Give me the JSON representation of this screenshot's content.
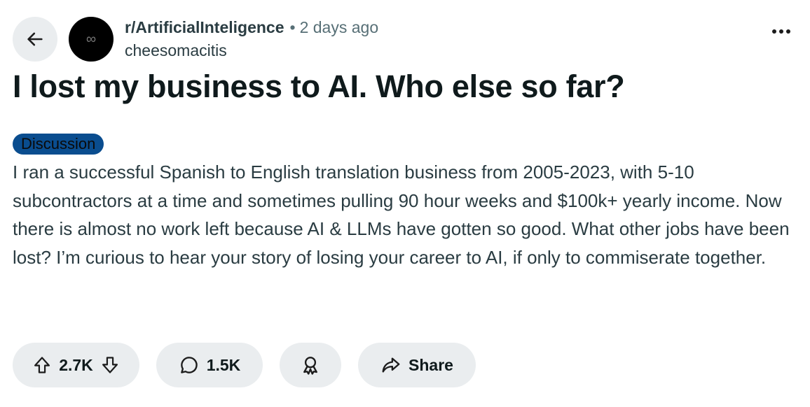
{
  "post": {
    "subreddit": "r/ArtificialInteligence",
    "separator": "•",
    "time": "2 days ago",
    "author": "cheesomacitis",
    "title": "I lost my business to AI. Who else so far?",
    "flair": "Discussion",
    "body": "I ran a successful Spanish to English translation business from 2005-2023, with 5-10 subcontractors at a time and sometimes pulling 90 hour weeks and $100k+ yearly income. Now there is almost no work left because AI & LLMs have gotten so good. What other jobs have been lost? I’m curious to hear your story of losing your career to AI, if only to commiserate together."
  },
  "avatar": {
    "glyph": "∞"
  },
  "actions": {
    "votes": "2.7K",
    "comments": "1.5K",
    "share_label": "Share"
  },
  "icons": {
    "back": "arrow-left-icon",
    "more": "more-horizontal-icon",
    "upvote": "upvote-arrow-icon",
    "downvote": "downvote-arrow-icon",
    "comment": "comment-bubble-icon",
    "award": "award-icon",
    "share": "share-arrow-icon"
  },
  "colors": {
    "pill_background": "#eaedef",
    "flair_background": "#0a4d8f",
    "avatar_background": "#000000"
  }
}
